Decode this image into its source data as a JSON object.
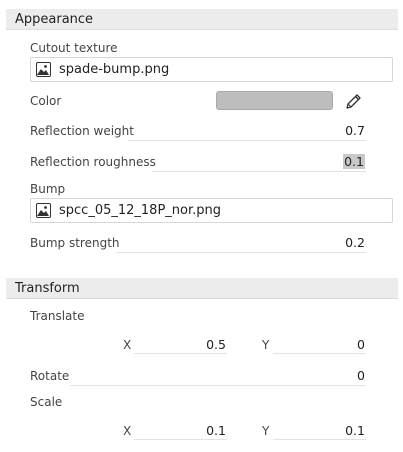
{
  "appearance": {
    "header": "Appearance",
    "cutout_texture": {
      "label": "Cutout texture",
      "file": "spade-bump.png",
      "icon": "image-icon"
    },
    "color": {
      "label": "Color",
      "swatch_hex": "#bdbdbd",
      "edit_icon": "pencil-icon"
    },
    "reflection_weight": {
      "label": "Reflection weight",
      "value": "0.7"
    },
    "reflection_roughness": {
      "label": "Reflection roughness",
      "value": "0.1"
    },
    "bump": {
      "label": "Bump",
      "file": "spcc_05_12_18P_nor.png",
      "icon": "image-icon"
    },
    "bump_strength": {
      "label": "Bump strength",
      "value": "0.2"
    }
  },
  "transform": {
    "header": "Transform",
    "translate": {
      "label": "Translate",
      "x_label": "X",
      "x_value": "0.5",
      "y_label": "Y",
      "y_value": "0"
    },
    "rotate": {
      "label": "Rotate",
      "value": "0"
    },
    "scale": {
      "label": "Scale",
      "x_label": "X",
      "x_value": "0.1",
      "y_label": "Y",
      "y_value": "0.1"
    }
  },
  "colors": {
    "header_bg": "#ececec",
    "swatch": "#bdbdbd",
    "selection": "#c8c8c8"
  }
}
